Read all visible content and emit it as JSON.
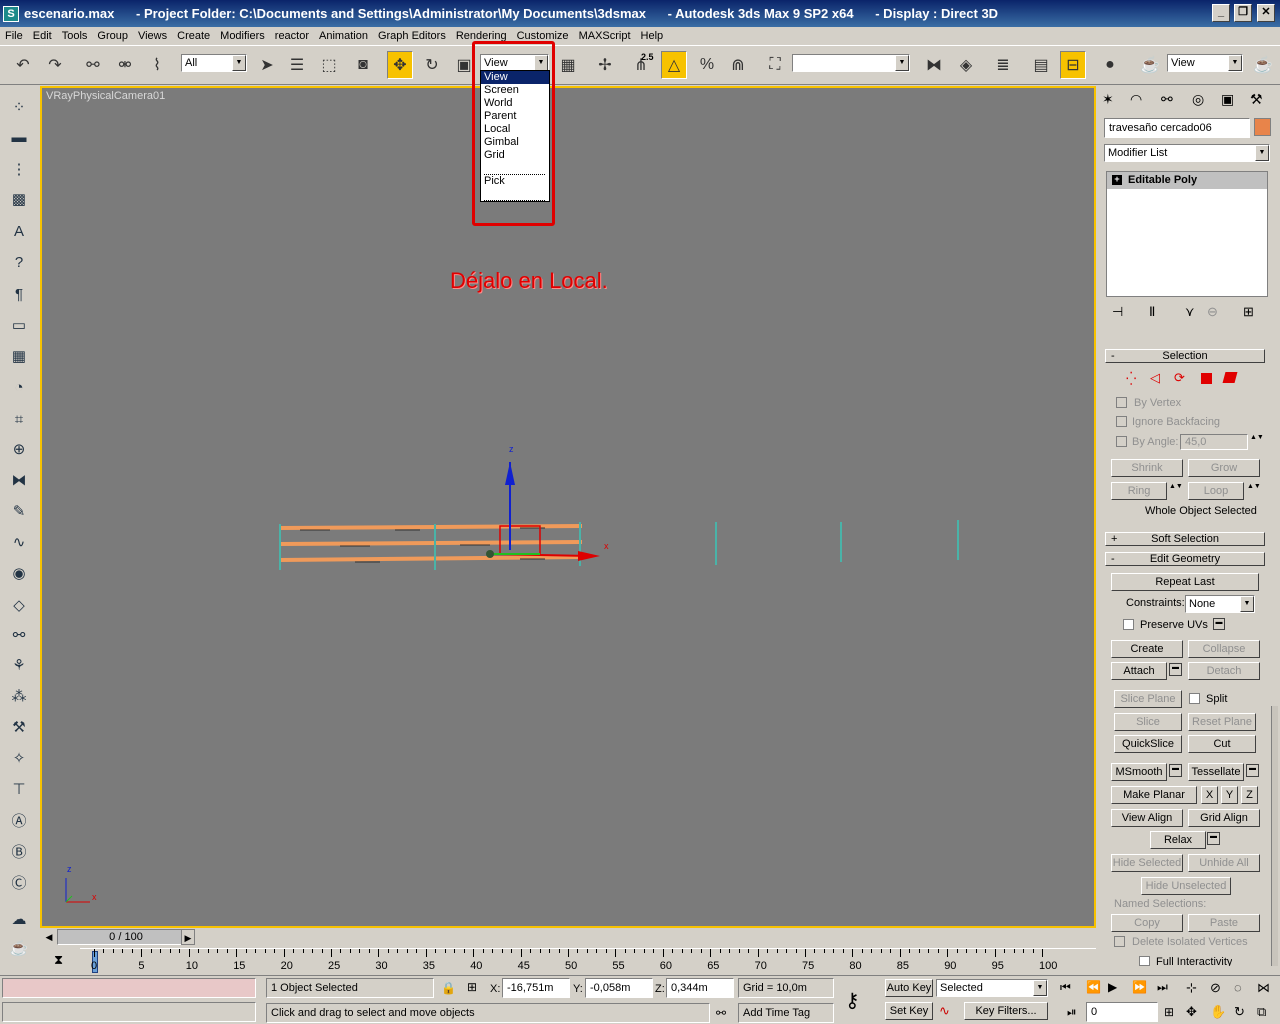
{
  "window": {
    "title": "escenario.max      - Project Folder: C:\\Documents and Settings\\Administrator\\My Documents\\3dsmax      - Autodesk 3ds Max 9 SP2 x64      - Display : Direct 3D"
  },
  "menu": [
    "File",
    "Edit",
    "Tools",
    "Group",
    "Views",
    "Create",
    "Modifiers",
    "reactor",
    "Animation",
    "Graph Editors",
    "Rendering",
    "Customize",
    "MAXScript",
    "Help"
  ],
  "toolbar": {
    "selection_filter": "All",
    "reference_coord": "View",
    "snap_angle_label": "2.5",
    "named_selection": "",
    "view_right": "View"
  },
  "coord_dropdown": {
    "options": [
      "View",
      "Screen",
      "World",
      "Parent",
      "Local",
      "Gimbal",
      "Grid",
      "Pick"
    ],
    "selected": "View"
  },
  "viewport": {
    "label": "VRayPhysicalCamera01",
    "annotation": "Déjalo en Local.",
    "gizmo_x": "x",
    "gizmo_z": "z",
    "axis_tripod_x": "x",
    "axis_tripod_z": "z"
  },
  "timeline": {
    "slider_text": "0 / 100",
    "ticks": [
      0,
      5,
      10,
      15,
      20,
      25,
      30,
      35,
      40,
      45,
      50,
      55,
      60,
      65,
      70,
      75,
      80,
      85,
      90,
      95,
      100
    ]
  },
  "status": {
    "selection_count": "1 Object Selected",
    "prompt": "Click and drag to select and move objects",
    "x_label": "X:",
    "x_value": "-16,751m",
    "y_label": "Y:",
    "y_value": "-0,058m",
    "z_label": "Z:",
    "z_value": "0,344m",
    "grid": "Grid = 10,0m",
    "add_time_tag": "Add Time Tag",
    "auto_key": "Auto Key",
    "set_key": "Set Key",
    "key_mode": "Selected",
    "key_filters": "Key Filters...",
    "frame": "0"
  },
  "command_panel": {
    "object_name": "travesaño cercado06",
    "object_color": "#e8844a",
    "modifier_list": "Modifier List",
    "stack_item": "Editable Poly",
    "selection": {
      "title": "Selection",
      "by_vertex": "By Vertex",
      "ignore_backfacing": "Ignore Backfacing",
      "by_angle": "By Angle:",
      "angle_value": "45,0",
      "shrink": "Shrink",
      "grow": "Grow",
      "ring": "Ring",
      "loop": "Loop",
      "status": "Whole Object Selected"
    },
    "soft_selection": "Soft Selection",
    "edit_geometry": {
      "title": "Edit Geometry",
      "repeat_last": "Repeat Last",
      "constraints_label": "Constraints:",
      "constraints_value": "None",
      "preserve_uvs": "Preserve UVs",
      "create": "Create",
      "collapse": "Collapse",
      "attach": "Attach",
      "detach": "Detach",
      "slice_plane": "Slice Plane",
      "split": "Split",
      "slice": "Slice",
      "reset_plane": "Reset Plane",
      "quickslice": "QuickSlice",
      "cut": "Cut",
      "msmooth": "MSmooth",
      "tessellate": "Tessellate",
      "make_planar": "Make Planar",
      "x": "X",
      "y": "Y",
      "z": "Z",
      "view_align": "View Align",
      "grid_align": "Grid Align",
      "relax": "Relax",
      "hide_selected": "Hide Selected",
      "unhide_all": "Unhide All",
      "hide_unselected": "Hide Unselected",
      "named_selections": "Named Selections:",
      "copy": "Copy",
      "paste": "Paste",
      "delete_isolated": "Delete Isolated Vertices",
      "full_interactivity": "Full Interactivity"
    }
  }
}
